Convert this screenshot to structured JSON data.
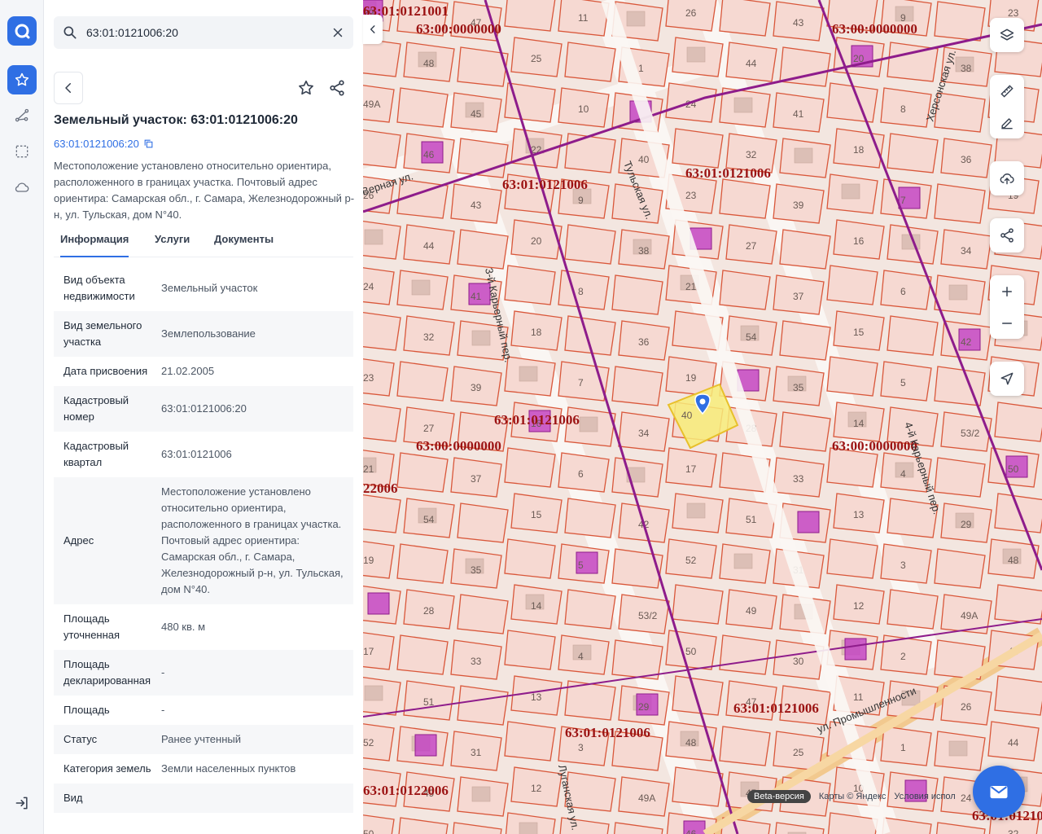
{
  "search": {
    "value": "63:01:0121006:20"
  },
  "object": {
    "title": "Земельный участок: 63:01:0121006:20",
    "cad_number": "63:01:0121006:20",
    "description": "Местоположение установлено относительно ориентира, расположенного в границах участка. Почтовый адрес ориентира: Самарская обл., г. Самара, Железнодорожный р-н, ул. Тульская, дом N°40."
  },
  "tabs": [
    {
      "label": "Информация"
    },
    {
      "label": "Услуги"
    },
    {
      "label": "Документы"
    }
  ],
  "info_rows": [
    {
      "key": "Вид объекта недвижимости",
      "value": "Земельный участок"
    },
    {
      "key": "Вид земельного участка",
      "value": "Землепользование"
    },
    {
      "key": "Дата присвоения",
      "value": "21.02.2005"
    },
    {
      "key": "Кадастровый номер",
      "value": "63:01:0121006:20"
    },
    {
      "key": "Кадастровый квартал",
      "value": "63:01:0121006"
    },
    {
      "key": "Адрес",
      "value": "Местоположение установлено относительно ориентира, расположенного в границах участка. Почтовый адрес ориентира: Самарская обл., г. Самара, Железнодорожный р-н, ул. Тульская, дом N°40."
    },
    {
      "key": "Площадь уточненная",
      "value": "480 кв. м"
    },
    {
      "key": "Площадь декларированная",
      "value": "-"
    },
    {
      "key": "Площадь",
      "value": "-"
    },
    {
      "key": "Статус",
      "value": "Ранее учтенный"
    },
    {
      "key": "Категория земель",
      "value": "Земли населенных пунктов"
    },
    {
      "key": "Вид",
      "value": ""
    }
  ],
  "map": {
    "streets": [
      "3-й Карьерный пер.",
      "Тульская ул.",
      "ул. Промышленности",
      "Луганская ул.",
      "Херсонская ул.",
      "4-й Карьерный пер.",
      "Верная ул."
    ],
    "quarters": [
      "63:00:0000000",
      "63:01:0121006",
      "63:01:0121001",
      "63:01:0122006",
      "22006"
    ],
    "parcels": [
      "29",
      "49А",
      "26",
      "24",
      "23",
      "21",
      "19",
      "17",
      "52",
      "50",
      "48",
      "46",
      "44",
      "32",
      "27",
      "54",
      "28",
      "51",
      "49",
      "47",
      "45",
      "43",
      "41",
      "39",
      "37",
      "35",
      "33",
      "31",
      "30",
      "25",
      "22",
      "20",
      "18",
      "16",
      "15",
      "14",
      "13",
      "12",
      "11",
      "10",
      "9",
      "8",
      "7",
      "6",
      "5",
      "4",
      "3",
      "2",
      "1",
      "40",
      "38",
      "36",
      "34",
      "42",
      "53/2"
    ],
    "selected_parcel": "40",
    "beta_label": "Beta-версия",
    "attribution": "Карты © Яндекс",
    "terms": "Условия испол"
  },
  "colors": {
    "accent": "#2f6fe4",
    "map_bg": "#f3e6e0",
    "parcel_stroke": "#d9573a",
    "quarter_stroke": "#8e1c8b",
    "building_fill": "#c23fc4",
    "selected_fill": "#f7ec7a",
    "label": "#9b1212"
  },
  "icons": {
    "rail": [
      "logo-icon",
      "star-icon",
      "route-icon",
      "selection-icon",
      "cloud-icon",
      "logout-icon"
    ],
    "tools": [
      "layers-icon",
      "ruler-icon",
      "edit-icon",
      "upload-icon",
      "share-icon",
      "zoom-in-icon",
      "zoom-out-icon",
      "locate-icon",
      "mail-icon"
    ]
  }
}
